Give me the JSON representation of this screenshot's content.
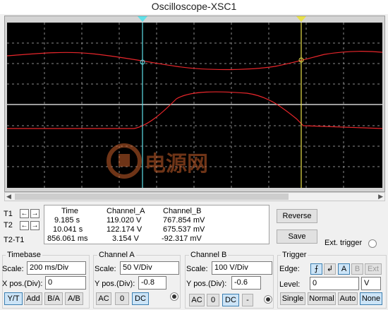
{
  "window": {
    "title": "Oscilloscope-XSC1"
  },
  "screen": {
    "t1_marker": "T1",
    "t2_marker": "T2",
    "watermark_text": "电源网"
  },
  "cursors": {
    "t1_label": "T1",
    "t2_label": "T2",
    "t2t1_label": "T2-T1"
  },
  "measurements": {
    "headers": [
      "Time",
      "Channel_A",
      "Channel_B"
    ],
    "rows": [
      [
        "9.185 s",
        "119.020 V",
        "767.854 mV"
      ],
      [
        "10.041 s",
        "122.174 V",
        "675.537 mV"
      ],
      [
        "856.061 ms",
        "3.154 V",
        "-92.317 mV"
      ]
    ]
  },
  "actions": {
    "reverse": "Reverse",
    "save": "Save",
    "ext_trigger": "Ext. trigger"
  },
  "timebase": {
    "title": "Timebase",
    "scale_label": "Scale:",
    "scale_value": "200 ms/Div",
    "xpos_label": "X pos.(Div):",
    "xpos_value": "0",
    "modes": [
      "Y/T",
      "Add",
      "B/A",
      "A/B"
    ],
    "selected_mode": "Y/T"
  },
  "channel_a": {
    "title": "Channel A",
    "scale_label": "Scale:",
    "scale_value": "50  V/Div",
    "ypos_label": "Y pos.(Div):",
    "ypos_value": "-0.8",
    "coupling": [
      "AC",
      "0",
      "DC"
    ],
    "selected_coupling": "DC"
  },
  "channel_b": {
    "title": "Channel B",
    "scale_label": "Scale:",
    "scale_value": "100  V/Div",
    "ypos_label": "Y pos.(Div):",
    "ypos_value": "-0.6",
    "coupling": [
      "AC",
      "0",
      "DC",
      "-"
    ],
    "selected_coupling": "DC"
  },
  "trigger": {
    "title": "Trigger",
    "edge_label": "Edge:",
    "edges": [
      "A",
      "B",
      "Ext"
    ],
    "level_label": "Level:",
    "level_value": "0",
    "level_unit": "V",
    "modes": [
      "Single",
      "Normal",
      "Auto",
      "None"
    ],
    "selected_mode": "None"
  },
  "colors": {
    "channel_a_trace": "#e8262b",
    "channel_b_trace": "#ffffff",
    "cursor_t1": "#5ee0e8",
    "cursor_t2": "#e8e04a",
    "grid": "#8a8a8a",
    "screen_bg": "#000000"
  }
}
